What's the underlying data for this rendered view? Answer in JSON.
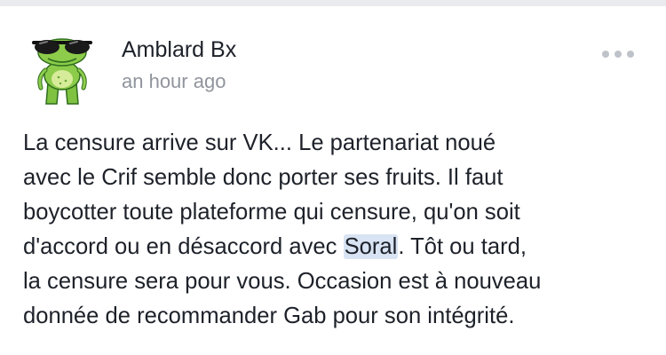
{
  "post": {
    "author": "Amblard Bx",
    "timestamp": "an hour ago",
    "more_icon": "more-horizontal-icon",
    "avatar_icon": "frog-sunglasses-avatar",
    "lines": [
      "La censure arrive sur VK... Le partenariat noué",
      "avec le Crif semble donc porter ses fruits. Il faut",
      "boycotter toute plateforme qui censure, qu'on soit"
    ],
    "line4_before": "d'accord ou en désaccord avec ",
    "line4_highlight": "Soral",
    "line4_after": ". Tôt ou tard,",
    "lines_end": [
      "la censure sera pour vous. Occasion est à nouveau",
      "donnée de recommander Gab pour son intégrité."
    ],
    "highlight_color": "#d8e4f3"
  }
}
